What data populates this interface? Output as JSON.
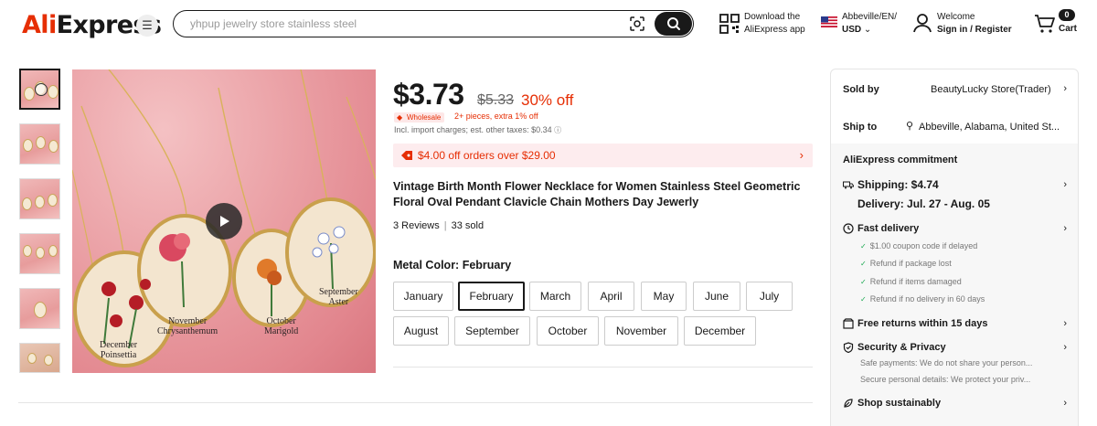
{
  "header": {
    "logo": {
      "part1": "Ali",
      "part2": "Express"
    },
    "search": {
      "placeholder": "yhpup jewelry store stainless steel"
    },
    "download": {
      "line1": "Download the",
      "line2": "AliExpress app"
    },
    "locale": {
      "line1": "Abbeville/EN/",
      "line2": "USD"
    },
    "account": {
      "line1": "Welcome",
      "line2": "Sign in / Register"
    },
    "cart": {
      "count": "0",
      "label": "Cart"
    }
  },
  "gallery": {
    "thumb_count": 6,
    "labels": {
      "september": {
        "l1": "September",
        "l2": "Aster"
      },
      "november": {
        "l1": "November",
        "l2": "Chrysanthemum"
      },
      "october": {
        "l1": "October",
        "l2": "Marigold"
      },
      "december": {
        "l1": "December",
        "l2": "Poinsettia"
      }
    }
  },
  "product": {
    "price": "$3.73",
    "original_price": "$5.33",
    "discount": "30% off",
    "wholesale_tag": "Wholesale",
    "wholesale_text": "2+ pieces, extra 1% off",
    "tax_line": "Incl. import charges; est. other taxes: $0.34",
    "coupon": "$4.00 off orders over $29.00",
    "title": "Vintage Birth Month Flower Necklace for Women Stainless Steel Geometric Floral Oval Pendant Clavicle Chain Mothers Day Jewerly",
    "reviews": "3 Reviews",
    "sold": "33 sold",
    "color_label": "Metal Color: February",
    "options": [
      "January",
      "February",
      "March",
      "April",
      "May",
      "June",
      "July",
      "August",
      "September",
      "October",
      "November",
      "December"
    ],
    "selected": "February"
  },
  "panel": {
    "sold_by_label": "Sold by",
    "sold_by_value": "BeautyLucky Store(Trader)",
    "ship_to_label": "Ship to",
    "ship_to_value": "Abbeville, Alabama, United St...",
    "commitment": "AliExpress commitment",
    "shipping": "Shipping: $4.74",
    "delivery": "Delivery: Jul. 27 - Aug. 05",
    "fast_delivery": "Fast delivery",
    "fast_items": [
      "$1.00 coupon code if delayed",
      "Refund if package lost",
      "Refund if items damaged",
      "Refund if no delivery in 60 days"
    ],
    "free_returns": "Free returns within 15 days",
    "security": "Security & Privacy",
    "security_items": [
      "Safe payments: We do not share your person...",
      "Secure personal details: We protect your priv..."
    ],
    "sustain": "Shop sustainably"
  },
  "colors": {
    "accent": "#e62e04",
    "dark": "#191919",
    "check": "#1aa84f"
  }
}
